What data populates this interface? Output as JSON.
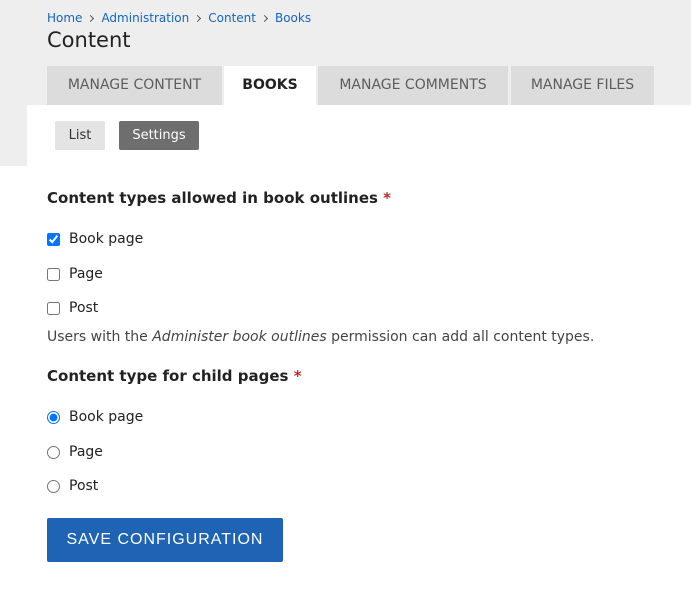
{
  "breadcrumb": [
    "Home",
    "Administration",
    "Content",
    "Books"
  ],
  "page_title": "Content",
  "tabs": [
    {
      "label": "Manage Content",
      "active": false
    },
    {
      "label": "Books",
      "active": true
    },
    {
      "label": "Manage Comments",
      "active": false
    },
    {
      "label": "Manage Files",
      "active": false
    }
  ],
  "subtabs": [
    {
      "label": "List",
      "active": false
    },
    {
      "label": "Settings",
      "active": true
    }
  ],
  "allowed_types": {
    "title": "Content types allowed in book outlines",
    "required_mark": "*",
    "options": [
      {
        "label": "Book page",
        "checked": true
      },
      {
        "label": "Page",
        "checked": false
      },
      {
        "label": "Post",
        "checked": false
      }
    ],
    "description_before": "Users with the ",
    "description_em": "Administer book outlines",
    "description_after": " permission can add all content types."
  },
  "child_type": {
    "title": "Content type for child pages",
    "required_mark": "*",
    "options": [
      {
        "label": "Book page",
        "selected": true
      },
      {
        "label": "Page",
        "selected": false
      },
      {
        "label": "Post",
        "selected": false
      }
    ]
  },
  "save_label": "Save configuration",
  "colors": {
    "accent": "#1e63b4",
    "link": "#1565c0",
    "required": "#c62828",
    "tab_bg": "#dcdcdc",
    "header_bg": "#eeeeee"
  }
}
